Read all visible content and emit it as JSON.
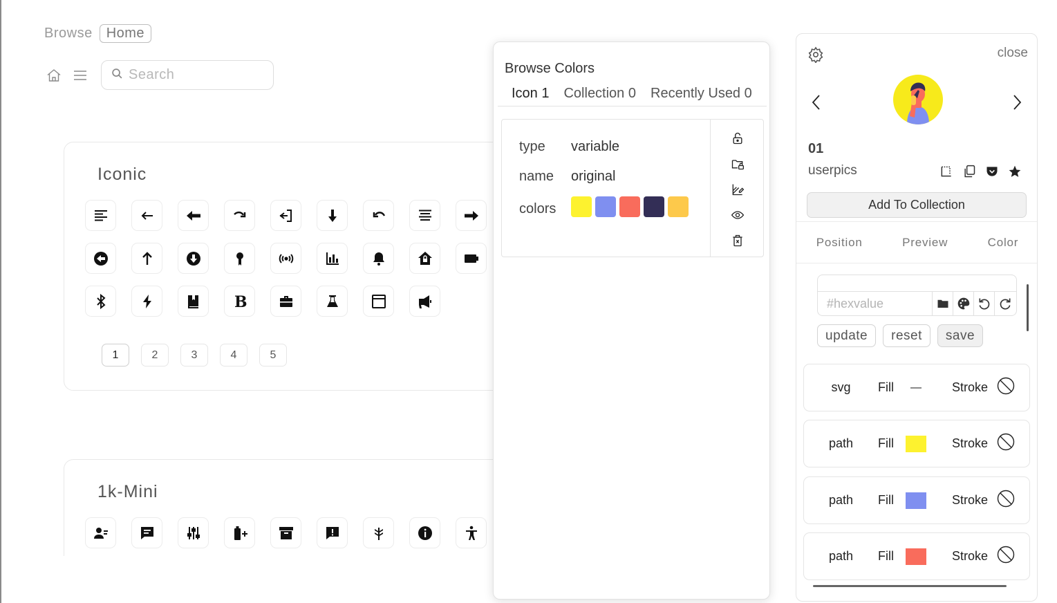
{
  "header": {
    "breadcrumb_browse": "Browse",
    "breadcrumb_home": "Home",
    "search_placeholder": "Search",
    "nav_icons": [
      "home-icon",
      "menu-icon",
      "search-icon"
    ]
  },
  "iconic": {
    "title": "Iconic",
    "icons": [
      "align-left-icon",
      "arrow-left-thin-icon",
      "arrow-left-bold-icon",
      "redo-icon",
      "log-out-icon",
      "arrow-down-icon",
      "undo-icon",
      "align-center-icon",
      "arrow-right-bold-icon",
      "arrow-left-circle-icon",
      "arrow-up-icon",
      "arrow-down-circle-icon",
      "award-icon",
      "broadcast-icon",
      "bar-chart-icon",
      "bell-icon",
      "home-lock-icon",
      "battery-icon",
      "bluetooth-icon",
      "bolt-icon",
      "book-icon",
      "bold-icon",
      "briefcase-icon",
      "beaker-icon",
      "browser-icon",
      "megaphone-icon"
    ],
    "pages": [
      "1",
      "2",
      "3",
      "4",
      "5"
    ],
    "active_page": "1"
  },
  "mini": {
    "title": "1k-Mini",
    "icons": [
      "user-icon",
      "chat-icon",
      "sliders-icon",
      "battery-plus-icon",
      "archive-icon",
      "alert-message-icon",
      "wheat-icon",
      "info-icon",
      "accessibility-icon"
    ]
  },
  "browse_colors": {
    "title": "Browse Colors",
    "tabs": [
      "Icon 1",
      "Collection 0",
      "Recently Used 0"
    ],
    "active_tab": "Icon 1",
    "info": {
      "type_label": "type",
      "type_value": "variable",
      "name_label": "name",
      "name_value": "original",
      "colors_label": "colors",
      "colors": [
        "#fdf22f",
        "#7f8ff0",
        "#f96c5c",
        "#332e56",
        "#fdc94b"
      ]
    },
    "actions": [
      "unlock-icon",
      "folder-lock-icon",
      "palette-edit-icon",
      "eye-icon",
      "trash-icon"
    ]
  },
  "detail": {
    "close_label": "close",
    "number": "01",
    "collection_name": "userpics",
    "avatar_bg": "#f7ea1b",
    "add_button": "Add To Collection",
    "tabs": [
      "Position",
      "Preview",
      "Color"
    ],
    "hex_placeholder": "#hexvalue",
    "buttons": {
      "update": "update",
      "reset": "reset",
      "save": "save"
    },
    "layers": [
      {
        "name": "svg",
        "fill_label": "Fill",
        "fill": "none",
        "stroke_label": "Stroke"
      },
      {
        "name": "path",
        "fill_label": "Fill",
        "fill": "#fdf22f",
        "stroke_label": "Stroke"
      },
      {
        "name": "path",
        "fill_label": "Fill",
        "fill": "#7f8ff0",
        "stroke_label": "Stroke"
      },
      {
        "name": "path",
        "fill_label": "Fill",
        "fill": "#f96c5c",
        "stroke_label": "Stroke"
      }
    ],
    "fill_none_glyph": "—"
  }
}
